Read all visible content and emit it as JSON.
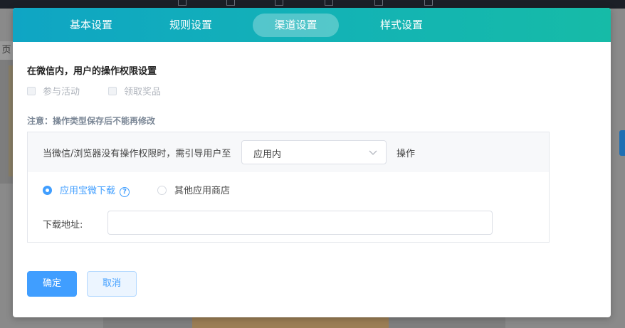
{
  "background": {
    "left_tab_label": "页"
  },
  "modal": {
    "tabs": [
      {
        "label": "基本设置",
        "active": false
      },
      {
        "label": "规则设置",
        "active": false
      },
      {
        "label": "渠道设置",
        "active": true
      },
      {
        "label": "样式设置",
        "active": false
      }
    ],
    "section_title": "在微信内，用户的操作权限设置",
    "checkboxes": [
      {
        "label": "参与活动",
        "checked": false,
        "disabled": true
      },
      {
        "label": "领取奖品",
        "checked": false,
        "disabled": true
      }
    ],
    "note": "注意：操作类型保存后不能再修改",
    "redirect": {
      "label": "当微信/浏览器没有操作权限时，需引导用户至",
      "select_value": "应用内",
      "suffix": "操作"
    },
    "radios": [
      {
        "label": "应用宝微下载",
        "selected": true
      },
      {
        "label": "其他应用商店",
        "selected": false
      }
    ],
    "download": {
      "label": "下载地址:",
      "value": "",
      "placeholder": ""
    },
    "buttons": {
      "ok_label": "确定",
      "cancel_label": "取消"
    }
  },
  "colors": {
    "tab_gradient_start": "#0fa5c4",
    "tab_gradient_end": "#16bba7",
    "primary": "#409eff",
    "note_text": "#7b8796"
  }
}
